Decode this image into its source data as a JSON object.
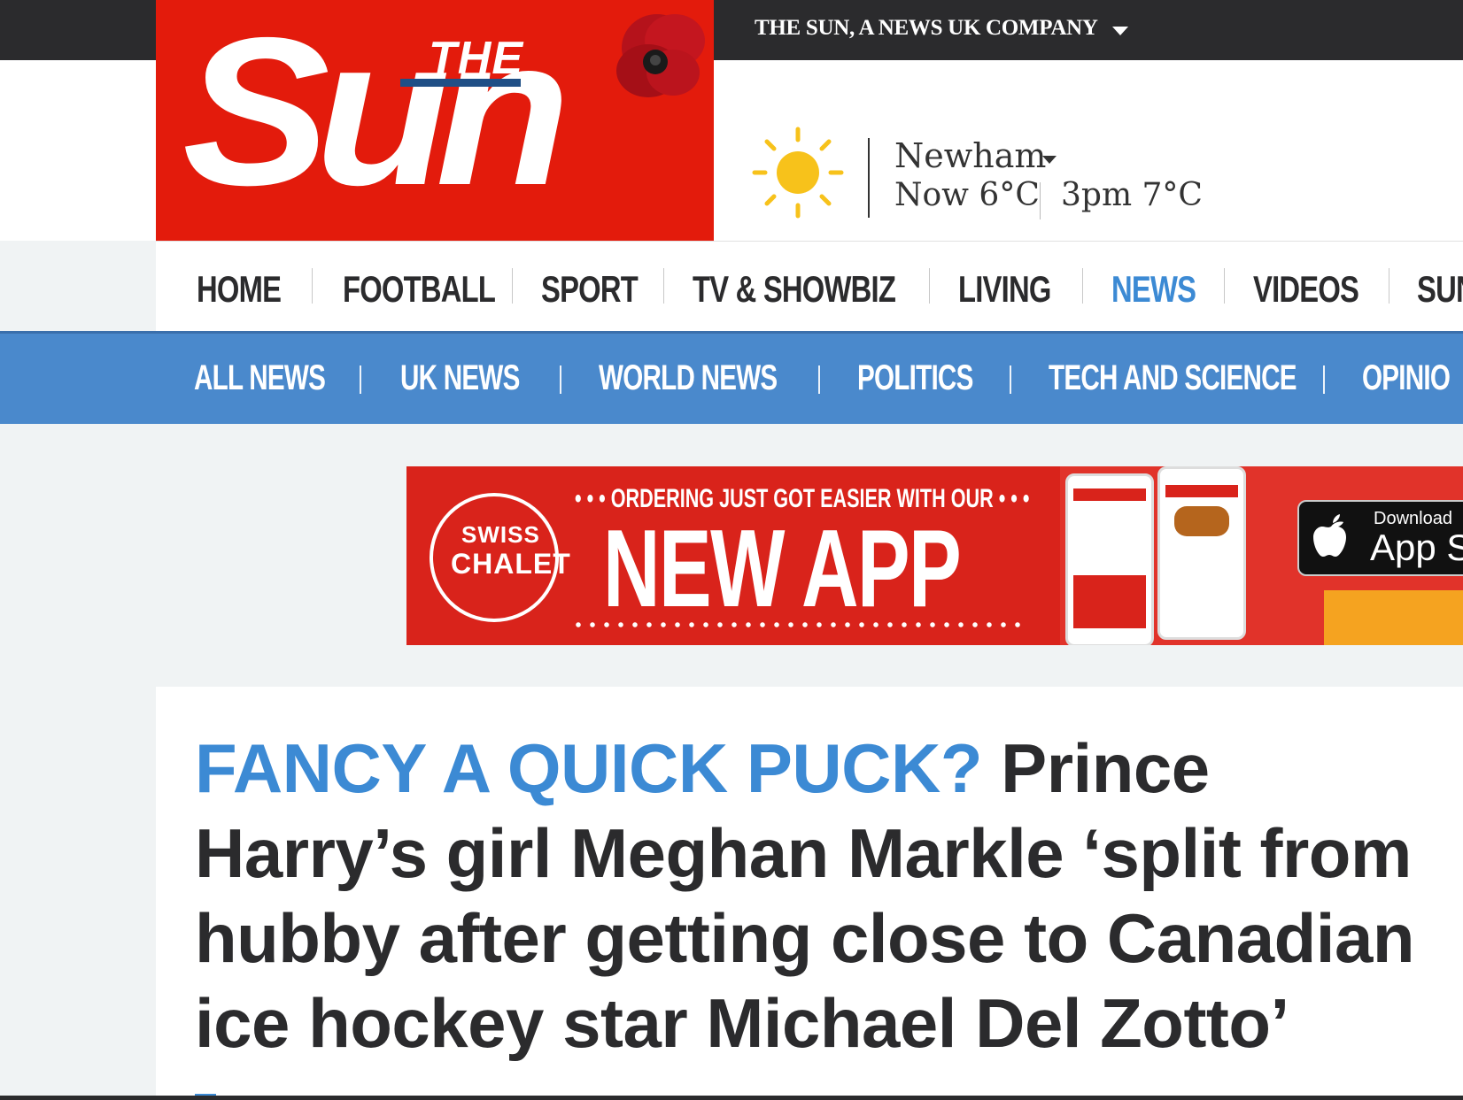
{
  "topbar": {
    "company_label": "THE SUN, A NEWS UK COMPANY"
  },
  "logo": {
    "the": "THE",
    "sun": "Sun"
  },
  "weather": {
    "location": "Newham",
    "now": "Now 6°C",
    "later": "3pm 7°C",
    "icon": "sun-icon"
  },
  "main_nav": {
    "items": [
      "HOME",
      "FOOTBALL",
      "SPORT",
      "TV & SHOWBIZ",
      "LIVING",
      "NEWS",
      "VIDEOS",
      "SUN"
    ],
    "active": "NEWS"
  },
  "sub_nav": {
    "items": [
      "ALL NEWS",
      "UK NEWS",
      "WORLD NEWS",
      "POLITICS",
      "TECH AND SCIENCE",
      "OPINIO"
    ],
    "active": "UK NEWS"
  },
  "ad": {
    "logo_line1": "SWISS",
    "logo_line2": "CHALET",
    "tagline": "• • • ORDERING JUST GOT EASIER WITH OUR • • •",
    "headline": "NEW APP",
    "store_small": "Download",
    "store_big": "App St"
  },
  "article": {
    "kicker": "FANCY A QUICK PUCK?",
    "headline": "Prince Harry’s girl Meghan Markle ‘split from hubby after getting close to Canadian ice hockey star Michael Del Zotto’"
  },
  "colors": {
    "brand_red": "#e31b0c",
    "accent_blue": "#3c8ad4",
    "subnav_blue": "#4a89cc",
    "dark": "#2b2b2d"
  }
}
